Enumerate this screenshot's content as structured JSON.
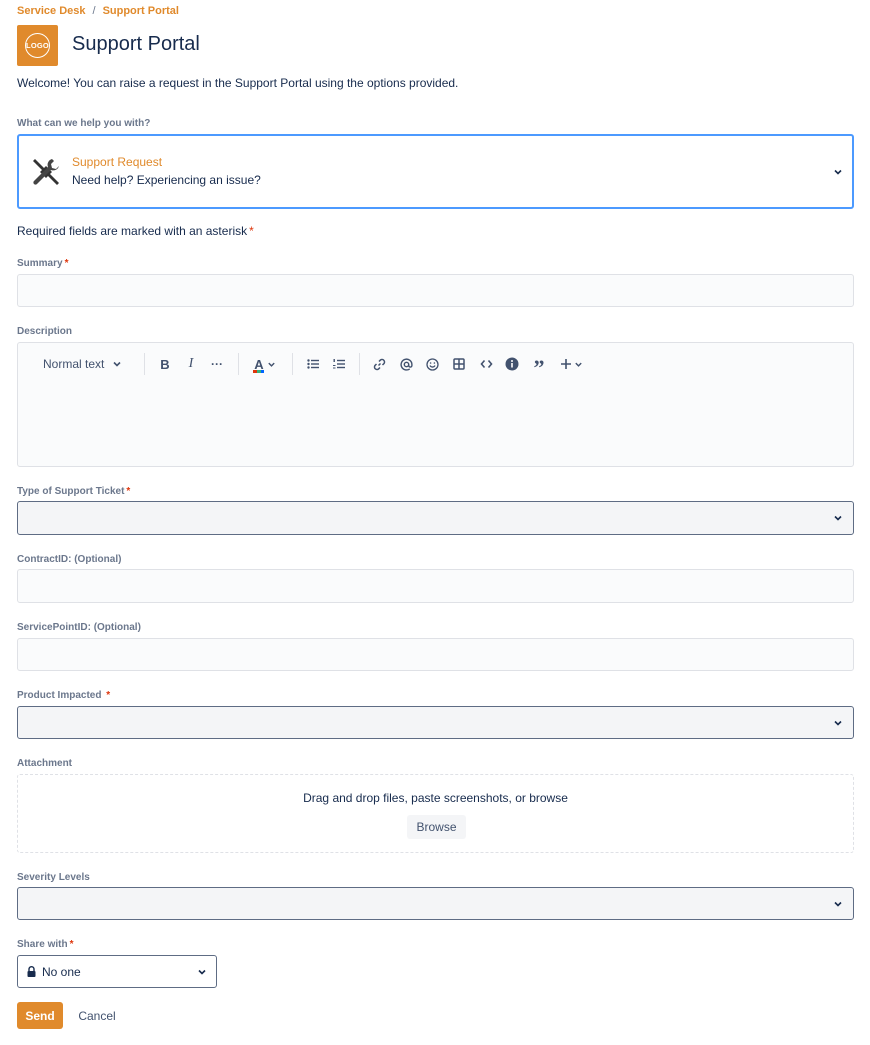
{
  "breadcrumb": {
    "item1": "Service Desk",
    "separator": "/",
    "item2": "Support Portal"
  },
  "header": {
    "logo_text": "LOGO",
    "title": "Support Portal"
  },
  "welcome": "Welcome! You can raise a request in the Support Portal using the options provided.",
  "request_type": {
    "label": "What can we help you with?",
    "name": "Support Request",
    "description": "Need help? Experiencing an issue?",
    "icon": "tools-icon"
  },
  "required_note": {
    "text": "Required fields are marked with an asterisk",
    "star": "*"
  },
  "summary": {
    "label": "Summary",
    "star": "*",
    "value": ""
  },
  "description": {
    "label": "Description",
    "toolbar": {
      "text_style": "Normal text",
      "bold": "B",
      "italic": "I",
      "more": "···",
      "text_color": "A",
      "quote": "”"
    }
  },
  "support_ticket_type": {
    "label": "Type of Support Ticket",
    "star": "*",
    "value": ""
  },
  "contract_id": {
    "label": "ContractID: (Optional)",
    "value": ""
  },
  "service_point_id": {
    "label": "ServicePointID: (Optional)",
    "value": ""
  },
  "product_impacted": {
    "label": "Product Impacted ",
    "star": "*",
    "value": ""
  },
  "attachment": {
    "label": "Attachment",
    "drop_text": "Drag and drop files, paste screenshots, or browse",
    "browse_label": "Browse"
  },
  "severity": {
    "label": "Severity Levels",
    "value": ""
  },
  "share_with": {
    "label": "Share with",
    "star": "*",
    "value": "No one",
    "icon": "lock-icon"
  },
  "actions": {
    "send": "Send",
    "cancel": "Cancel"
  },
  "colors": {
    "accent": "#e08a2c",
    "focus": "#4c9aff",
    "required": "#de350b"
  }
}
